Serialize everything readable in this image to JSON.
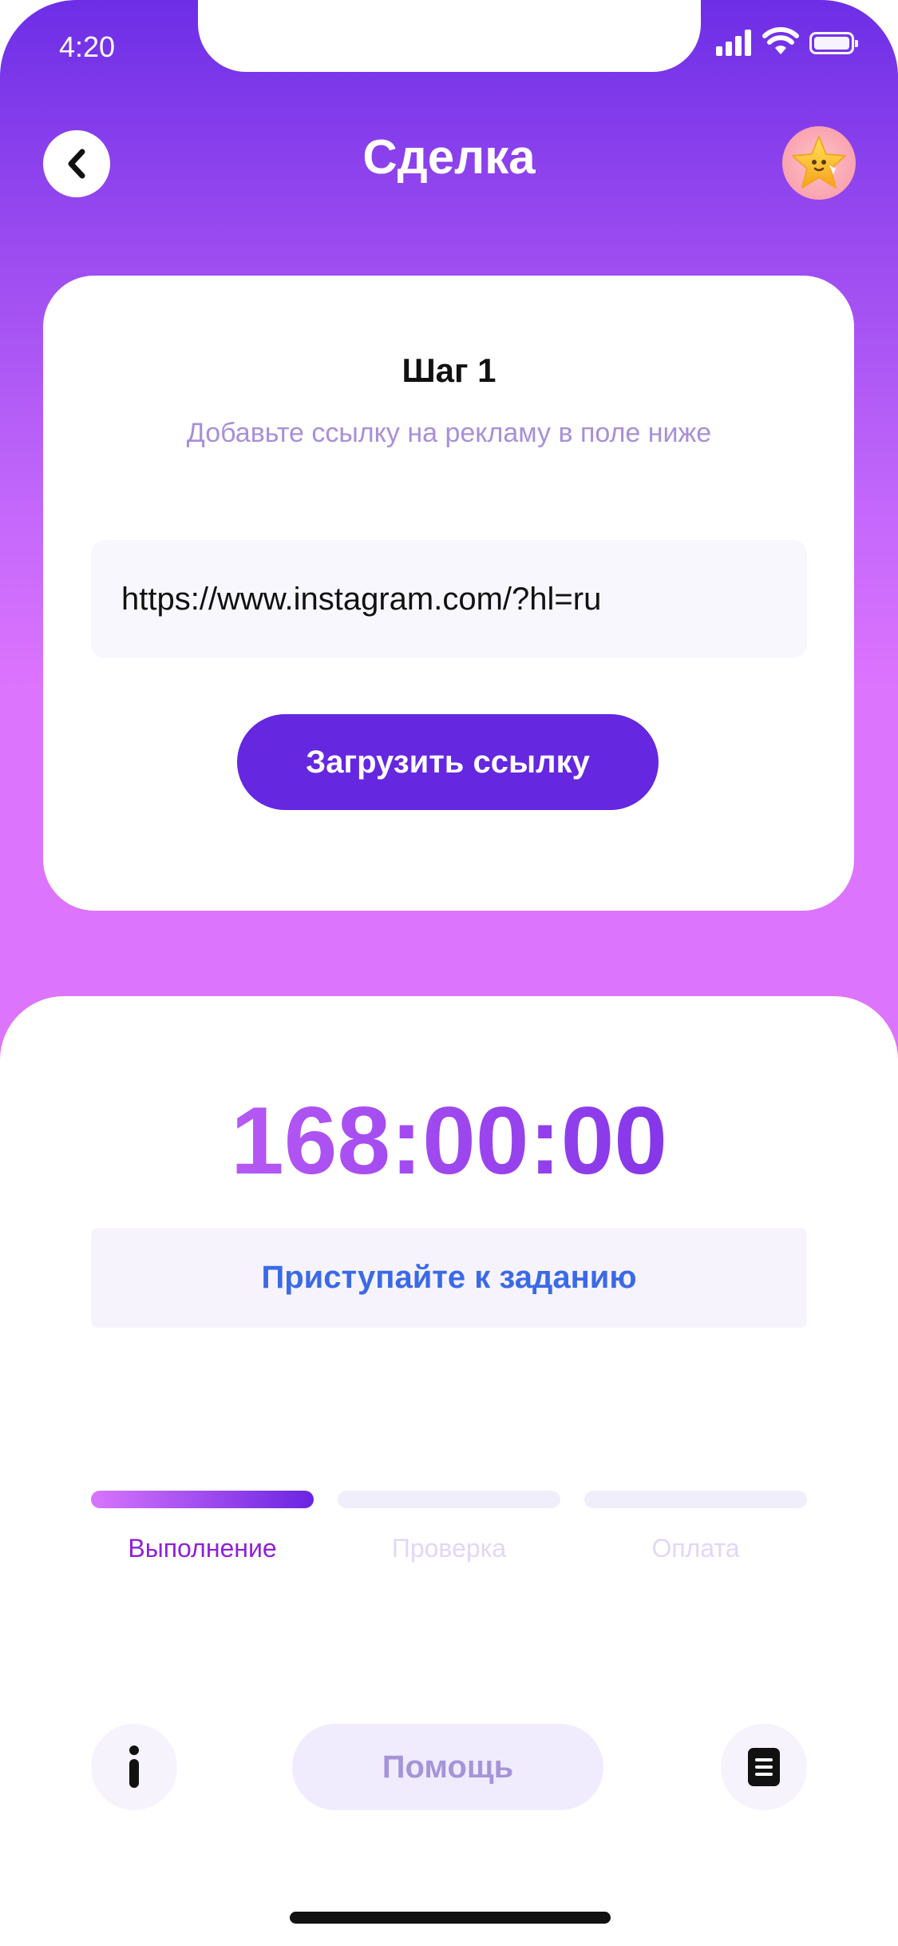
{
  "status_bar": {
    "time": "4:20"
  },
  "header": {
    "title": "Сделка",
    "back_icon": "chevron-left-icon",
    "avatar_icon": "star-avatar-icon"
  },
  "step_card": {
    "title": "Шаг 1",
    "subtitle": "Добавьте ссылку на рекламу в поле ниже",
    "url_value": "https://www.instagram.com/?hl=ru",
    "upload_label": "Загрузить ссылку"
  },
  "timer": {
    "value": "168:00:00"
  },
  "task": {
    "label": "Приступайте к заданию"
  },
  "progress": {
    "steps": [
      {
        "label": "Выполнение",
        "active": true
      },
      {
        "label": "Проверка",
        "active": false
      },
      {
        "label": "Оплата",
        "active": false
      }
    ]
  },
  "actions": {
    "info_icon": "info-icon",
    "help_label": "Помощь",
    "doc_icon": "document-icon"
  },
  "colors": {
    "primary": "#6527e0",
    "gradient_top": "#6d2ee6",
    "gradient_bottom": "#dd74fd",
    "task_text": "#3b6ae6"
  }
}
